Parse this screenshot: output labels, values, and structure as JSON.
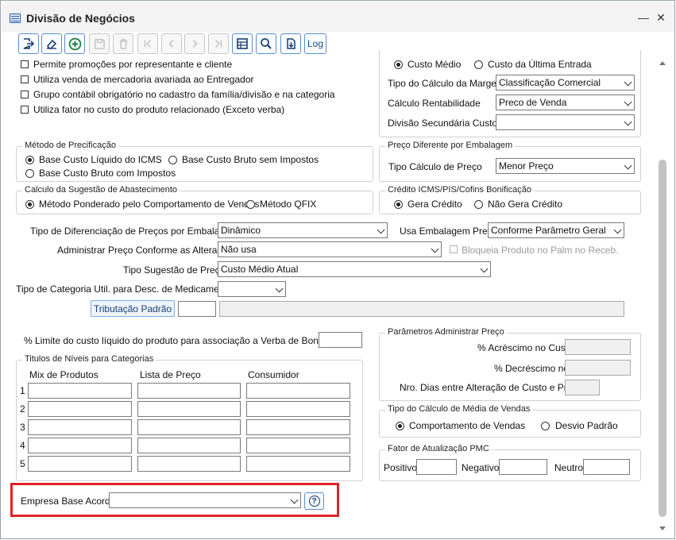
{
  "window": {
    "title": "Divisão de Negócios",
    "minimize_icon": "minimize-icon",
    "close_icon": "close-icon",
    "minimize_glyph": "—",
    "close_glyph": "✕"
  },
  "toolbar": {
    "items": [
      {
        "icon": "exit-icon",
        "enabled": true
      },
      {
        "icon": "eraser-icon",
        "enabled": true
      },
      {
        "icon": "add-icon",
        "enabled": true
      },
      {
        "icon": "save-icon",
        "enabled": false
      },
      {
        "icon": "delete-icon",
        "enabled": false
      },
      {
        "icon": "first-icon",
        "enabled": false
      },
      {
        "icon": "previous-icon",
        "enabled": false
      },
      {
        "icon": "next-icon",
        "enabled": false
      },
      {
        "icon": "last-icon",
        "enabled": false
      },
      {
        "icon": "grid-icon",
        "enabled": true
      },
      {
        "icon": "search-icon",
        "enabled": true
      },
      {
        "icon": "export-icon",
        "enabled": true
      }
    ],
    "log_label": "Log"
  },
  "options": {
    "checkboxes": [
      "Permite promoções por representante e cliente",
      "Utiliza venda de mercadoria avariada ao Entregador",
      "Grupo contábil obrigatório no cadastro da família/divisão e na categoria",
      "Utiliza fator no custo do produto relacionado (Exceto verba)"
    ]
  },
  "custo": {
    "radio_medio": "Custo Médio",
    "radio_ultima": "Custo da Última Entrada",
    "selected": "Custo Médio",
    "tipo_calculo_margem_label": "Tipo do Cálculo da Margem",
    "tipo_calculo_margem_value": "Classificação Comercial",
    "calculo_rentabilidade_label": "Cálculo Rentabilidade",
    "calculo_rentabilidade_value": "Preco de Venda",
    "divisao_secundaria_label": "Divisão Secundária Custo",
    "divisao_secundaria_value": ""
  },
  "metodo_precificacao": {
    "title": "Método de Precificação",
    "options": [
      "Base Custo Líquido do ICMS",
      "Base Custo Bruto sem Impostos",
      "Base Custo Bruto com Impostos"
    ],
    "selected": "Base Custo Líquido do ICMS"
  },
  "preco_embalagem": {
    "title": "Preço Diferente por Embalagem",
    "label": "Tipo Cálculo de Preço",
    "value": "Menor Preço"
  },
  "sugestao_abastecimento": {
    "title": "Calculo da Sugestão de Abastecimento",
    "options": [
      "Método Ponderado pelo Comportamento de Vendas",
      "Método QFIX"
    ],
    "selected": "Método Ponderado pelo Comportamento de Vendas"
  },
  "credito_icms": {
    "title": "Crédito ICMS/PIS/Cofins Bonificação",
    "options": [
      "Gera Crédito",
      "Não Gera Crédito"
    ],
    "selected": "Gera Crédito"
  },
  "form": {
    "tipo_diferenciacao_label": "Tipo de Diferenciação de Preços por Embalagem",
    "tipo_diferenciacao_value": "Dinâmico",
    "usa_embalagem_label": "Usa Embalagem Preço",
    "usa_embalagem_value": "Conforme Parâmetro Geral",
    "administrar_preco_label": "Administrar Preço Conforme as Alterações",
    "administrar_preco_value": "Não usa",
    "bloqueia_label": "Bloqueia Produto no Palm no Receb.",
    "tipo_sugestao_label": "Tipo Sugestão de Preço",
    "tipo_sugestao_value": "Custo Médio Atual",
    "tipo_categoria_label": "Tipo de Categoria Util. para Desc. de Medicamentos",
    "tipo_categoria_value": "",
    "tributacao_button": "Tributação Padrão",
    "limite_custo_label": "% Limite do custo líquido do produto para associação a Verba de Bonificação"
  },
  "titulos_niveis": {
    "title": "Titulos de Níveis para Categorias",
    "columns": [
      "Mix de Produtos",
      "Lista de Preço",
      "Consumidor"
    ],
    "rows": [
      "1",
      "2",
      "3",
      "4",
      "5"
    ]
  },
  "parametros_preco": {
    "title": "Parâmetros Administrar Preço",
    "acrescimo_label": "% Acréscimo no Custo",
    "decrescimo_label": "% Decréscimo no",
    "nro_dias_label": "Nro. Dias entre Alteração de Custo e Preço"
  },
  "media_vendas": {
    "title": "Tipo do Cálculo de Média de Vendas",
    "options": [
      "Comportamento de Vendas",
      "Desvio Padrão"
    ],
    "selected": "Comportamento de Vendas"
  },
  "fator_pmc": {
    "title": "Fator de Atualização PMC",
    "positivo_label": "Positivo",
    "negativo_label": "Negativo",
    "neutro_label": "Neutro"
  },
  "empresa_base": {
    "label": "Empresa Base Acordo",
    "value": "",
    "help_icon": "help-icon",
    "help_glyph": "?"
  },
  "colors": {
    "highlight": "#e02424",
    "toolbar_border": "#5b8fcc",
    "button_text": "#1a3d73"
  }
}
